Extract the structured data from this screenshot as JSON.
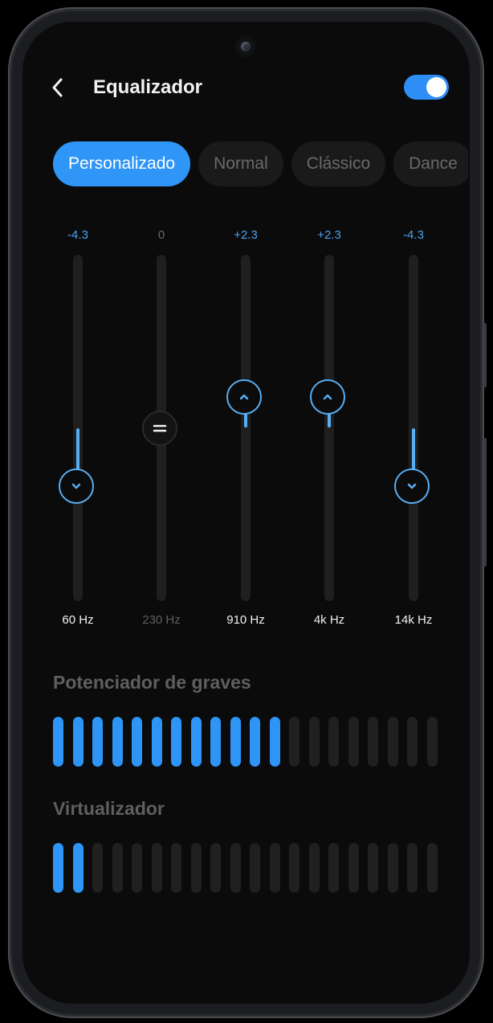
{
  "header": {
    "title": "Equalizador",
    "back_icon": "chevron-left-icon",
    "enabled": true
  },
  "presets": [
    {
      "label": "Personalizado",
      "active": true
    },
    {
      "label": "Normal",
      "active": false
    },
    {
      "label": "Clássico",
      "active": false
    },
    {
      "label": "Dance",
      "active": false
    }
  ],
  "equalizer": {
    "range_db": [
      -12,
      12
    ],
    "bands": [
      {
        "freq": "60 Hz",
        "value": -4.3,
        "value_label": "-4.3",
        "direction": "down"
      },
      {
        "freq": "230 Hz",
        "value": 0,
        "value_label": "0",
        "direction": "neutral"
      },
      {
        "freq": "910 Hz",
        "value": 2.3,
        "value_label": "+2.3",
        "direction": "up"
      },
      {
        "freq": "4k Hz",
        "value": 2.3,
        "value_label": "+2.3",
        "direction": "up"
      },
      {
        "freq": "14k Hz",
        "value": -4.3,
        "value_label": "-4.3",
        "direction": "down"
      }
    ]
  },
  "bass_boost": {
    "title": "Potenciador de graves",
    "level": 12,
    "max": 20
  },
  "virtualizer": {
    "title": "Virtualizador",
    "level": 2,
    "max": 20
  },
  "colors": {
    "accent": "#2f95f7",
    "slider_accent": "#58aef3",
    "background": "#0b0b0b"
  }
}
